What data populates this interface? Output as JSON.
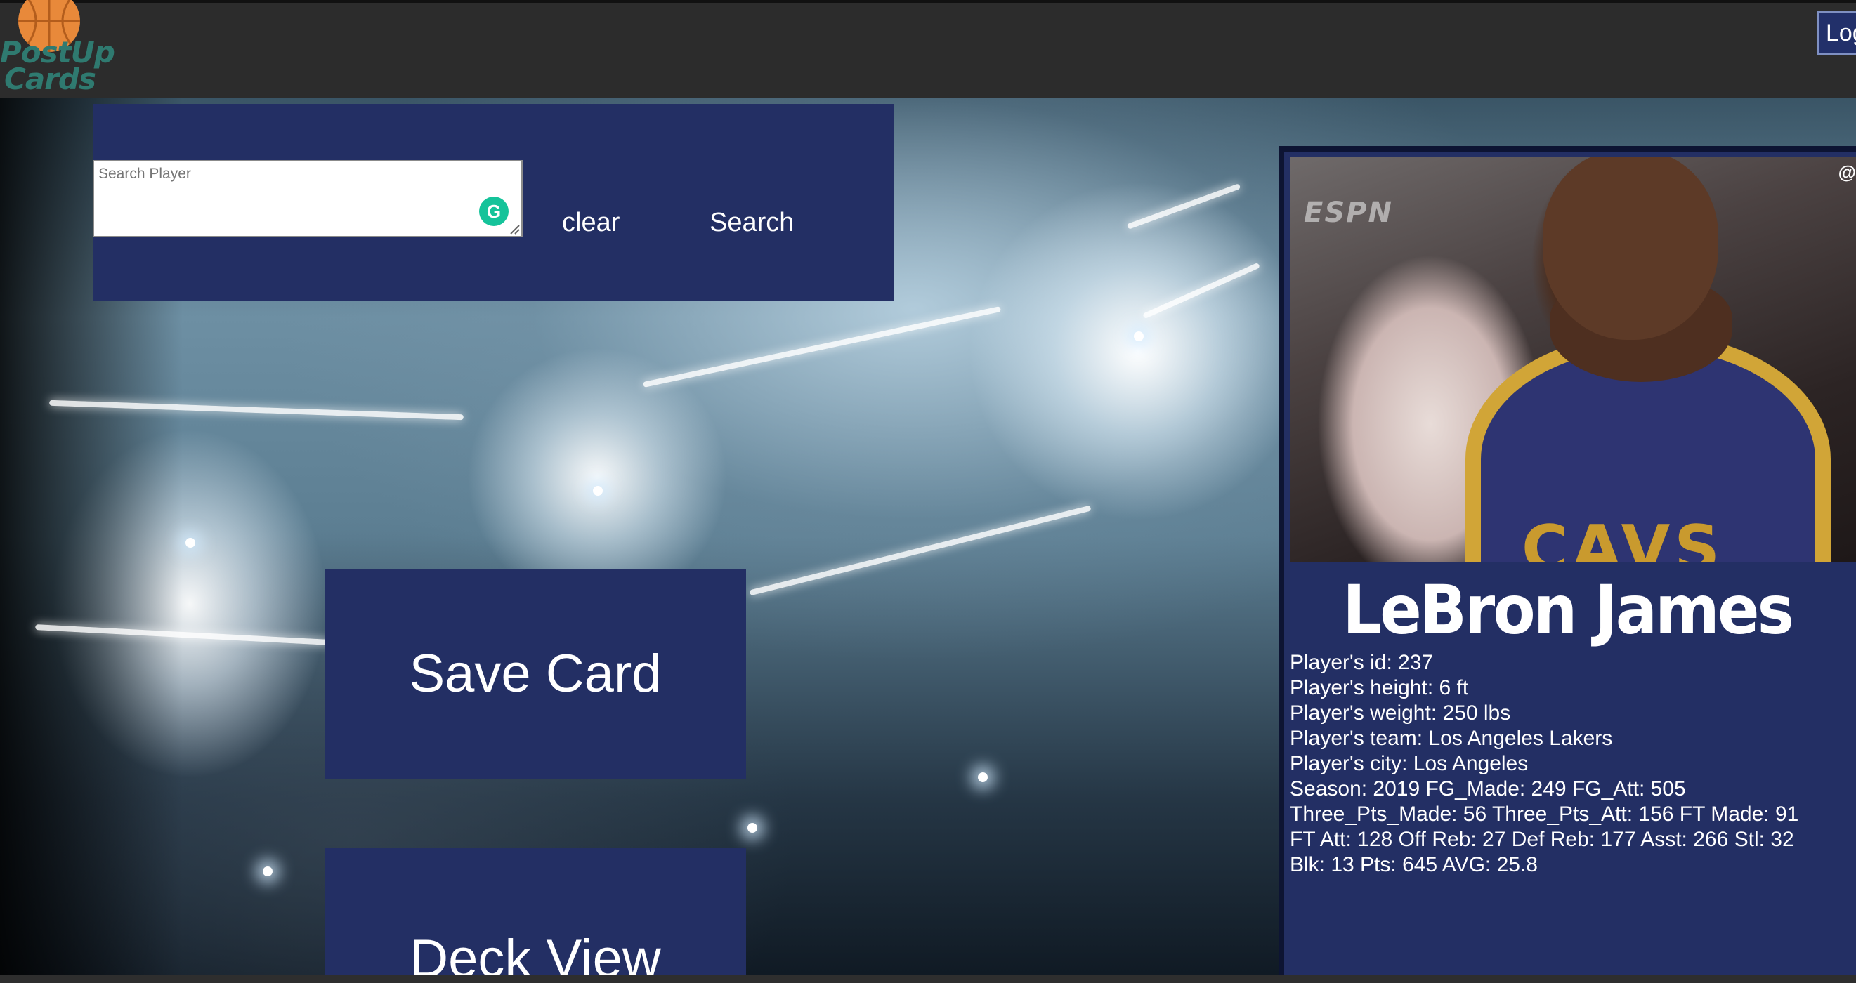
{
  "header": {
    "logo_line1": "PostUp",
    "logo_line2": "Cards",
    "login_label": "Log"
  },
  "search": {
    "placeholder": "Search Player",
    "value": "",
    "clear_label": "clear",
    "search_label": "Search"
  },
  "actions": {
    "save_label": "Save Card",
    "deck_label": "Deck View"
  },
  "card": {
    "photo_logo": "ESPN",
    "photo_handle": "@",
    "jersey_text": "CAVS",
    "name": "LeBron James",
    "stats": [
      "Player's id: 237",
      "Player's height: 6 ft",
      "Player's weight: 250 lbs",
      "Player's team: Los Angeles Lakers",
      "Player's city: Los Angeles",
      "Season: 2019 FG_Made: 249 FG_Att: 505",
      "Three_Pts_Made: 56 Three_Pts_Att: 156 FT Made: 91",
      "FT Att: 128 Off Reb: 27 Def Reb: 177 Asst: 266 Stl: 32",
      "Blk: 13 Pts: 645 AVG: 25.8"
    ]
  },
  "colors": {
    "panel": "#232f64",
    "topbar": "#2c2c2c",
    "logo_ball": "#e8893a",
    "logo_text": "#2f7a70",
    "grammarly": "#15c39a"
  },
  "icons": {
    "logo": "basketball-icon",
    "grammarly": "grammarly-icon",
    "resize": "resize-grip-icon"
  }
}
